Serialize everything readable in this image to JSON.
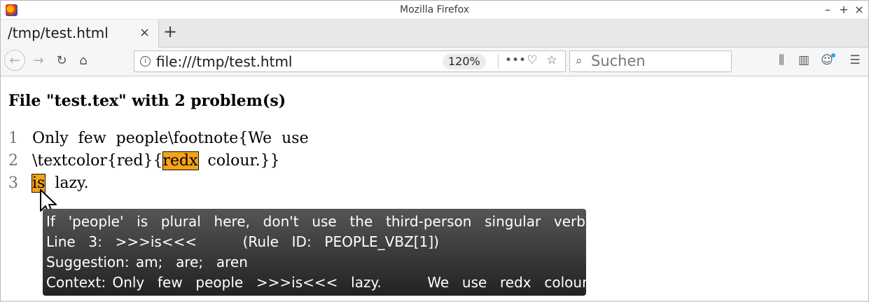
{
  "window": {
    "title": "Mozilla Firefox",
    "min": "–",
    "max": "+",
    "close": "×"
  },
  "tab": {
    "title": "/tmp/test.html",
    "close": "×",
    "new": "+"
  },
  "nav": {
    "url": "file:///tmp/test.html",
    "zoom": "120%",
    "search_placeholder": "Suchen"
  },
  "page": {
    "heading": "File \"test.tex\" with 2 problem(s)",
    "lines": [
      {
        "num": "1",
        "pre": "Only  few  people\\footnote{We  use",
        "err": "",
        "post": ""
      },
      {
        "num": "2",
        "pre": "\\textcolor{red}{",
        "err": "redx",
        "post": "  colour.}}"
      },
      {
        "num": "3",
        "pre": "",
        "err": "is",
        "post": "  lazy."
      }
    ]
  },
  "tooltip": {
    "message": "If  'people'  is  plural  here,  don't  use  the  third-person  singular  verb.",
    "line": "Line  3:  >>>is<<<       (Rule  ID:  PEOPLE_VBZ[1])",
    "suggestion": "Suggestion: am;  are;  aren",
    "context": "Context: Only  few  people  >>>is<<<  lazy.       We  use  redx  colour."
  },
  "colors": {
    "highlight": "#f5a31a",
    "tooltip_bg": "#333333"
  }
}
